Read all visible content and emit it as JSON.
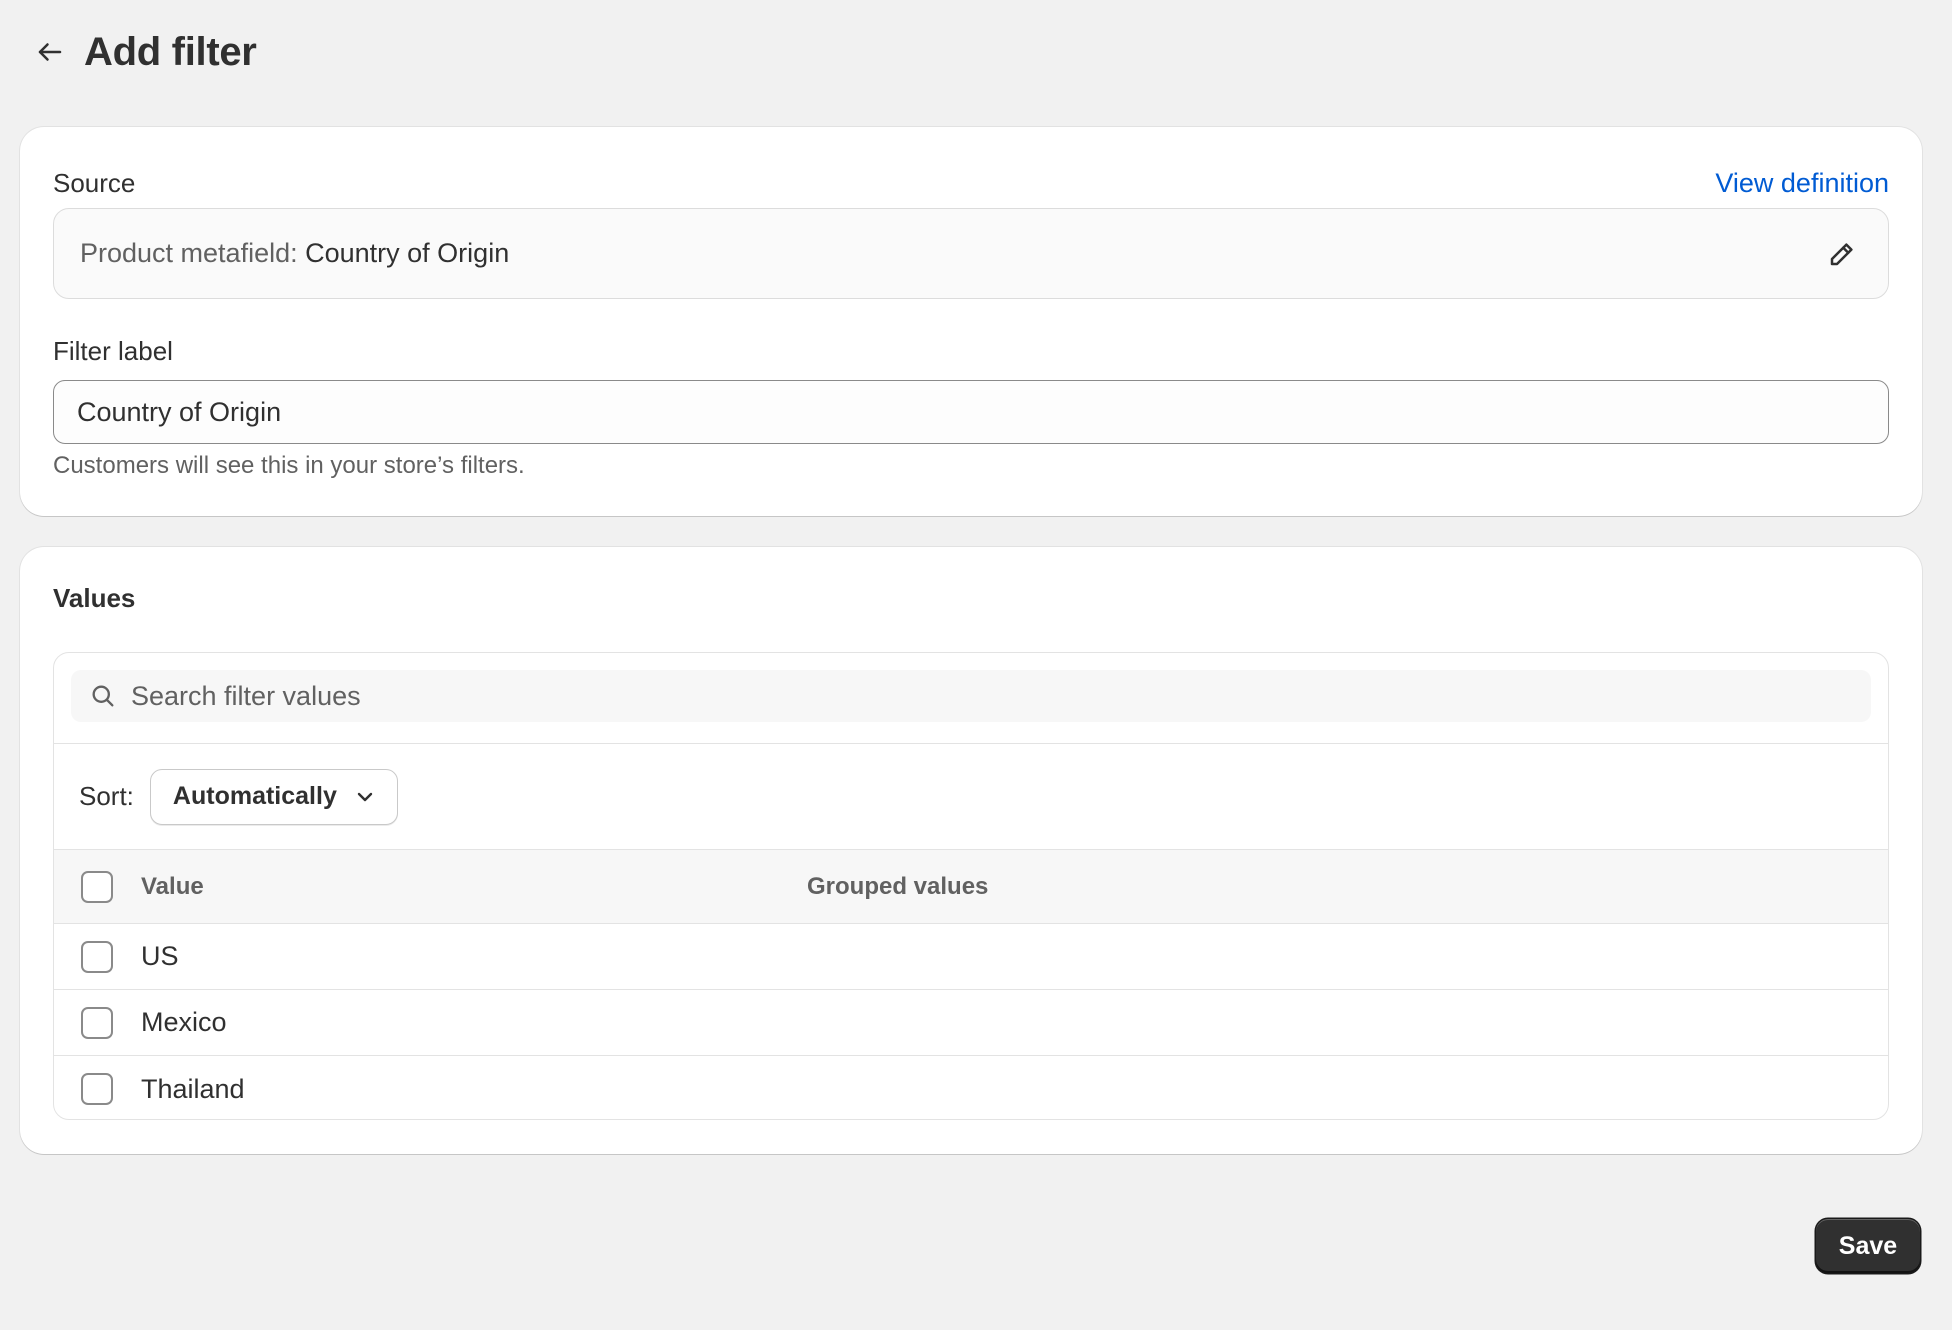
{
  "header": {
    "back_icon": "arrow-left-icon",
    "title": "Add filter"
  },
  "source": {
    "label": "Source",
    "view_definition_link": "View definition",
    "field_prefix": "Product metafield:",
    "field_value": "Country of Origin",
    "edit_icon": "pencil-icon"
  },
  "filter_label": {
    "label": "Filter label",
    "value": "Country of Origin",
    "help_text": "Customers will see this in your store’s filters."
  },
  "values": {
    "title": "Values",
    "search": {
      "icon": "search-icon",
      "placeholder": "Search filter values"
    },
    "sort": {
      "label": "Sort:",
      "selected": "Automatically",
      "icon": "chevron-down-icon"
    },
    "columns": [
      "Value",
      "Grouped values"
    ],
    "rows": [
      {
        "value": "US",
        "grouped": ""
      },
      {
        "value": "Mexico",
        "grouped": ""
      },
      {
        "value": "Thailand",
        "grouped": ""
      }
    ]
  },
  "footer": {
    "save_label": "Save"
  },
  "colors": {
    "background": "#f1f1f1",
    "card": "#ffffff",
    "link": "#005bd3",
    "primary_button": "#303030",
    "text": "#303030",
    "subdued_text": "#616161"
  }
}
